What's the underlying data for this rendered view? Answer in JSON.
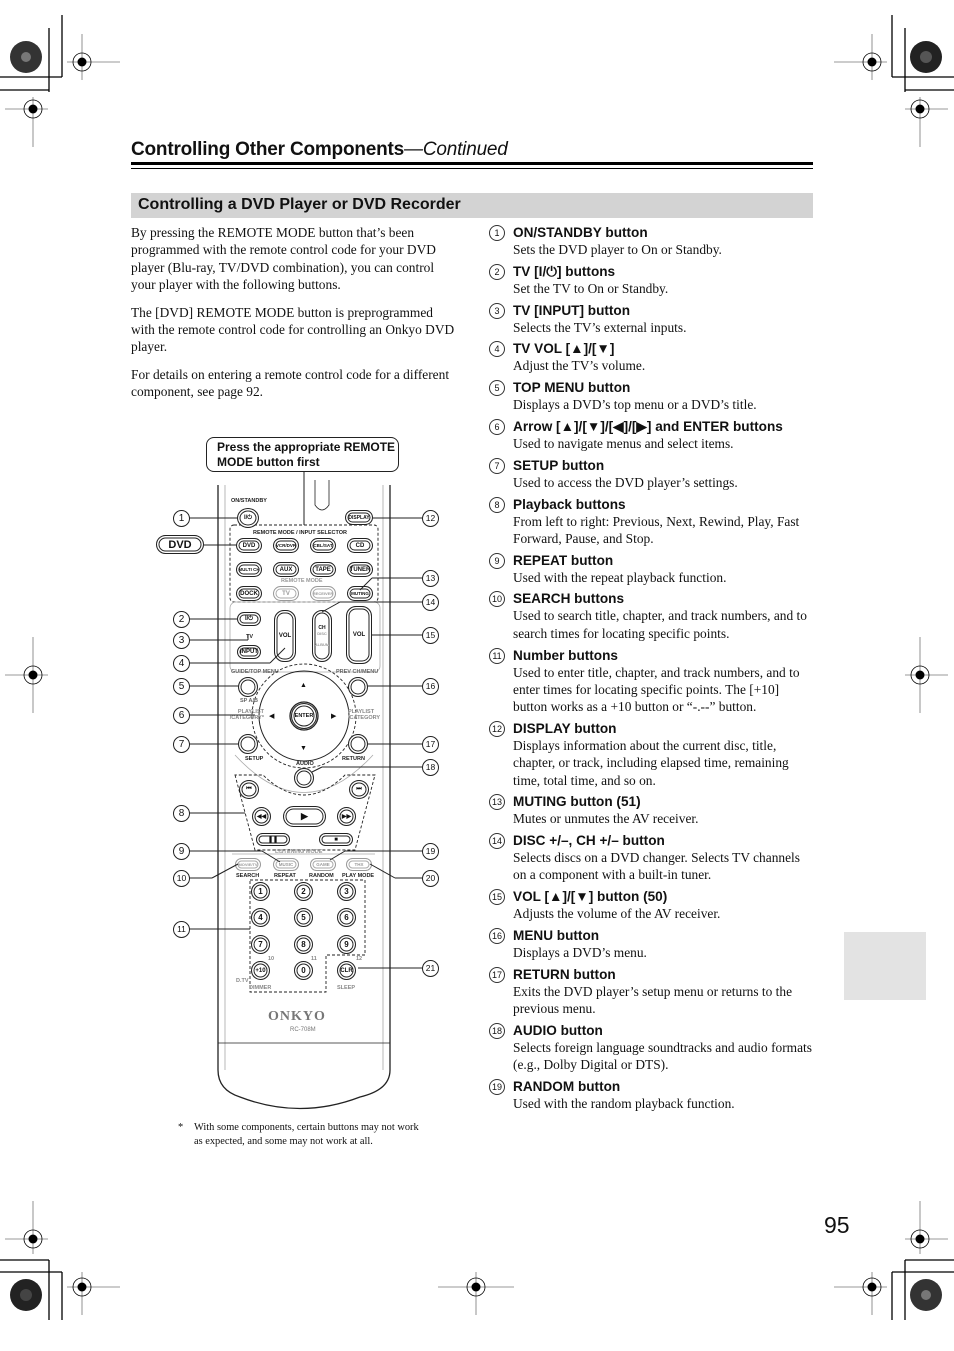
{
  "header": {
    "title": "Controlling Other Components",
    "continued": "—Continued"
  },
  "section": {
    "title": "Controlling a DVD Player or DVD Recorder"
  },
  "intro": {
    "paragraphs": [
      "By pressing the REMOTE MODE button that’s been programmed with the remote control code for your DVD player (Blu-ray, TV/DVD combination), you can control your player with the following buttons.",
      "The [DVD] REMOTE MODE button is preprogrammed with the remote control code for controlling an Onkyo DVD player.",
      "For details on entering a remote control code for a different component, see page 92."
    ]
  },
  "items": [
    {
      "num": "1",
      "title": "ON/STANDBY button",
      "desc": "Sets the DVD player to On or Standby."
    },
    {
      "num": "2",
      "title": "TV [I/⏻] buttons",
      "desc": "Set the TV to On or Standby."
    },
    {
      "num": "3",
      "title": "TV [INPUT] button",
      "desc": "Selects the TV’s external inputs."
    },
    {
      "num": "4",
      "title": "TV VOL [▲]/[▼]",
      "desc": "Adjust the TV’s volume."
    },
    {
      "num": "5",
      "title": "TOP MENU button",
      "desc": "Displays a DVD’s top menu or a DVD’s title."
    },
    {
      "num": "6",
      "title": "Arrow [▲]/[▼]/[◀]/[▶] and ENTER buttons",
      "desc": "Used to navigate menus and select items."
    },
    {
      "num": "7",
      "title": "SETUP button",
      "desc": "Used to access the DVD player’s settings."
    },
    {
      "num": "8",
      "title": "Playback buttons",
      "desc": "From left to right: Previous, Next, Rewind, Play, Fast Forward, Pause, and Stop."
    },
    {
      "num": "9",
      "title": "REPEAT button",
      "desc": "Used with the repeat playback function."
    },
    {
      "num": "10",
      "title": "SEARCH buttons",
      "desc": "Used to search title, chapter, and track numbers, and to search times for locating specific points."
    },
    {
      "num": "11",
      "title": "Number buttons",
      "desc": "Used to enter title, chapter, and track numbers, and to enter times for locating specific points. The [+10] button works as a +10 button or “-.--” button."
    },
    {
      "num": "12",
      "title": "DISPLAY button",
      "desc": "Displays information about the current disc, title, chapter, or track, including elapsed time, remaining time, total time, and so on."
    },
    {
      "num": "13",
      "title": "MUTING button (51)",
      "desc": "Mutes or unmutes the AV receiver."
    },
    {
      "num": "14",
      "title": "DISC +/–, CH +/– button",
      "desc": "Selects discs on a DVD changer. Selects TV channels on a component with a built-in tuner."
    },
    {
      "num": "15",
      "title": "VOL [▲]/[▼] button (50)",
      "desc": "Adjusts the volume of the AV receiver."
    },
    {
      "num": "16",
      "title": "MENU button",
      "desc": "Displays a DVD’s menu."
    },
    {
      "num": "17",
      "title": "RETURN button",
      "desc": "Exits the DVD player’s setup menu or returns to the previous menu."
    },
    {
      "num": "18",
      "title": "AUDIO button",
      "desc": "Selects foreign language soundtracks and audio formats (e.g., Dolby Digital or DTS)."
    },
    {
      "num": "19",
      "title": "RANDOM button",
      "desc": "Used with the random playback function."
    }
  ],
  "diagram": {
    "callout": "Press the appropriate REMOTE MODE button first",
    "mode_badge": "DVD",
    "brand": "ONKYO",
    "model": "RC-708M",
    "labels": {
      "on_standby": "ON/STANDBY",
      "remote_mode_input_selector": "REMOTE MODE / INPUT SELECTOR",
      "remote_mode": "REMOTE MODE",
      "tv": "TV",
      "guide_top_menu": "GUIDE/TOP MENU",
      "prev_ch_menu": "PREV CH/MENU",
      "sp_ab": "SP A/B",
      "playlist_left": "PLAYLIST /CATEGORY*",
      "playlist_right": "PLAYLIST /CATEGORY",
      "setup": "SETUP",
      "return": "RETURN",
      "audio": "AUDIO",
      "listening_mode": "LISTENING MODE",
      "search": "SEARCH",
      "repeat": "REPEAT",
      "random": "RANDOM",
      "play_mode": "PLAY MODE",
      "dimmer": "DIMMER",
      "sleep": "SLEEP",
      "dtv": "D.TV",
      "n10": "10",
      "n11": "11",
      "n12": "12"
    },
    "buttons": {
      "power": "I/⏻",
      "display": "DISPLAY",
      "dvd": "DVD",
      "vcr_dvr": "VCR/DVR",
      "cbl_sat": "CBL/SAT",
      "cd": "CD",
      "multich": "MULTI CH",
      "aux": "AUX",
      "tape": "TAPE",
      "tuner": "TUNER",
      "dock": "DOCK",
      "mode_tv": "TV",
      "mode_receiver": "RECEIVER",
      "muting": "MUTING",
      "tv_power": "I/⏻",
      "tv_input": "INPUT",
      "tv_vol": "VOL",
      "ch_disc": "CH",
      "disc": "DISC",
      "album": "ALBUM",
      "vol": "VOL",
      "enter": "ENTER",
      "movie_tv": "MOVIE/TV",
      "music": "MUSIC",
      "game": "GAME",
      "thx": "THX",
      "numbers": [
        "1",
        "2",
        "3",
        "4",
        "5",
        "6",
        "7",
        "8",
        "9",
        "+10",
        "0",
        "CLR"
      ]
    },
    "callouts": [
      "1",
      "2",
      "3",
      "4",
      "5",
      "6",
      "7",
      "8",
      "9",
      "10",
      "11",
      "12",
      "13",
      "14",
      "15",
      "16",
      "17",
      "18",
      "19",
      "20",
      "21"
    ]
  },
  "footnote": {
    "star": "*",
    "text": "With some components, certain buttons may not work as expected, and some may not work at all."
  },
  "page_number": "95"
}
